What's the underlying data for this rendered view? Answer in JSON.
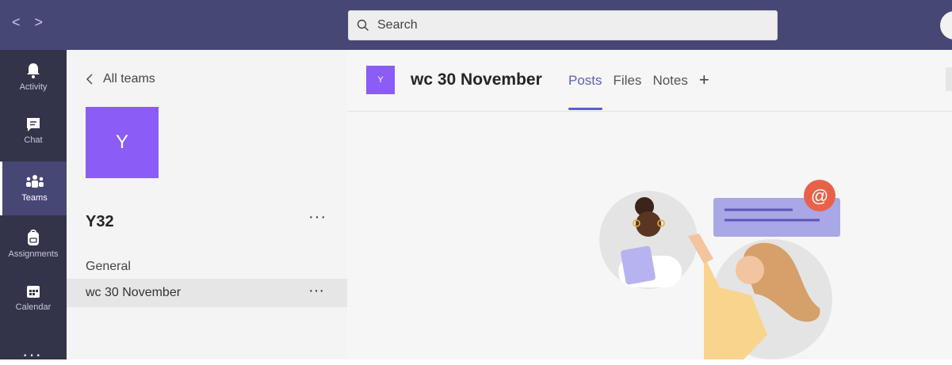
{
  "topbar": {
    "back_glyph": "<",
    "forward_glyph": ">",
    "search_placeholder": "Search"
  },
  "rail": {
    "items": [
      {
        "label": "Activity",
        "icon": "bell-icon"
      },
      {
        "label": "Chat",
        "icon": "chat-icon"
      },
      {
        "label": "Teams",
        "icon": "teams-icon",
        "active": true
      },
      {
        "label": "Assignments",
        "icon": "backpack-icon"
      },
      {
        "label": "Calendar",
        "icon": "calendar-icon"
      }
    ],
    "more_glyph": "···"
  },
  "teams_panel": {
    "back_label": "All teams",
    "team_tile_letter": "Y",
    "team_name": "Y32",
    "more_glyph": "···",
    "channels": [
      {
        "name": "General",
        "selected": false
      },
      {
        "name": "wc 30 November",
        "selected": true
      }
    ]
  },
  "main": {
    "tile_letter": "Y",
    "channel_title": "wc 30 November",
    "tabs": [
      {
        "label": "Posts",
        "active": true
      },
      {
        "label": "Files",
        "active": false
      },
      {
        "label": "Notes",
        "active": false
      }
    ],
    "add_tab_glyph": "+",
    "mention_symbol": "@"
  },
  "colors": {
    "topbar": "#464775",
    "rail": "#33344a",
    "team_tile": "#8b5cf6",
    "accent": "#5b5fc7"
  }
}
